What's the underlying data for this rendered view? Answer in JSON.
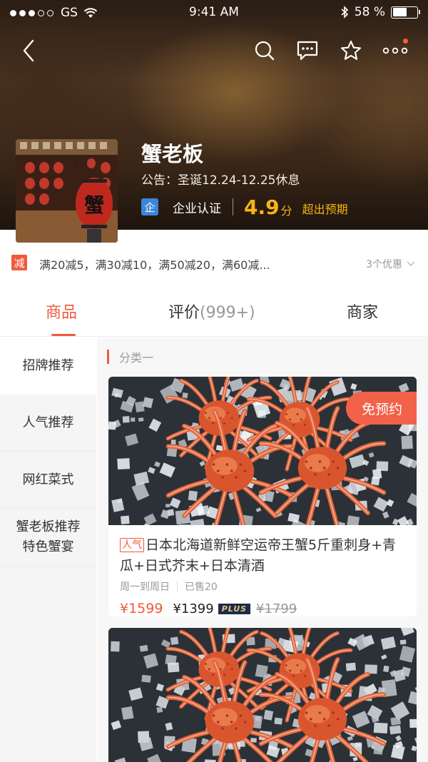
{
  "status_bar": {
    "carrier": "GS",
    "time": "9:41 AM",
    "battery_text": "58 %",
    "battery_level": 0.58
  },
  "nav": {
    "icons": [
      "back-icon",
      "search-icon",
      "message-icon",
      "star-icon",
      "more-icon"
    ]
  },
  "shop": {
    "name": "蟹老板",
    "notice": "公告：圣诞12.24-12.25休息",
    "cert_icon": "企",
    "cert_label": "企业认证",
    "score": "4.9",
    "score_unit": "分",
    "score_note": "超出预期"
  },
  "promo": {
    "icon": "减",
    "text": "满20减5，满30减10，满50减20，满60减...",
    "count": "3个优惠"
  },
  "tabs": {
    "goods": "商品",
    "reviews": "评价",
    "reviews_count": "(999+)",
    "merchant": "商家"
  },
  "categories": [
    {
      "label": "招牌推荐",
      "active": true
    },
    {
      "label": "人气推荐",
      "active": false
    },
    {
      "label": "网红菜式",
      "active": false
    },
    {
      "label": "蟹老板推荐特色蟹宴",
      "active": false
    }
  ],
  "section": {
    "title": "分类一"
  },
  "products": [
    {
      "tag_free": "免预约",
      "hot_tag": "人气",
      "title": "日本北海道新鲜空运帝王蟹5斤重刺身+青瓜+日式芥末+日本清酒",
      "schedule": "周一到周日",
      "sold": "已售20",
      "price": "¥1599",
      "plus_price": "¥1399",
      "plus_badge": "PLUS",
      "original_price": "¥1799"
    }
  ],
  "colors": {
    "accent": "#f05a3c",
    "score": "#f8b415",
    "cert": "#3b86d8"
  }
}
